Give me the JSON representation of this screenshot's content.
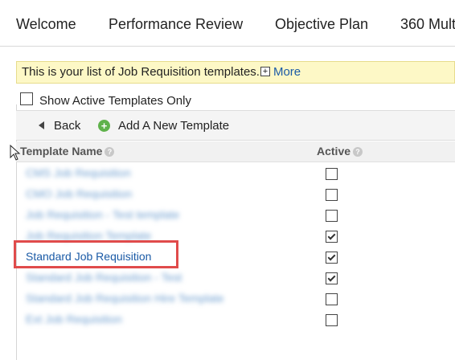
{
  "topnav": {
    "tabs": [
      {
        "label": "Welcome"
      },
      {
        "label": "Performance Review"
      },
      {
        "label": "Objective Plan"
      },
      {
        "label": "360 Mult"
      }
    ]
  },
  "info": {
    "message": "This is your list of Job Requisition templates.",
    "expand_symbol": "+",
    "more_label": "More"
  },
  "filters": {
    "active_only_label": "Show Active Templates Only",
    "active_only_checked": false
  },
  "toolbar": {
    "back_label": "Back",
    "add_label": "Add A New Template",
    "add_symbol": "+"
  },
  "table": {
    "columns": {
      "name": "Template Name",
      "active": "Active",
      "help_symbol": "?"
    },
    "rows": [
      {
        "name": "CMS Job Requisition",
        "active": false,
        "blurred": true
      },
      {
        "name": "CMO Job Requisition",
        "active": false,
        "blurred": true
      },
      {
        "name": "Job Requisition - Test template",
        "active": false,
        "blurred": true
      },
      {
        "name": "Job Requisition Template",
        "active": true,
        "blurred": true
      },
      {
        "name": "Standard Job Requisition",
        "active": true,
        "blurred": false
      },
      {
        "name": "Standard Job Requisition - Test",
        "active": true,
        "blurred": true
      },
      {
        "name": "Standard Job Requisition Hire Template",
        "active": false,
        "blurred": true
      },
      {
        "name": "Ext Job Requisition",
        "active": false,
        "blurred": true
      }
    ]
  },
  "colors": {
    "link": "#1a5aa6",
    "info_bg": "#fdf8c6",
    "highlight": "#e04b4b",
    "add_icon": "#5fb24b"
  }
}
